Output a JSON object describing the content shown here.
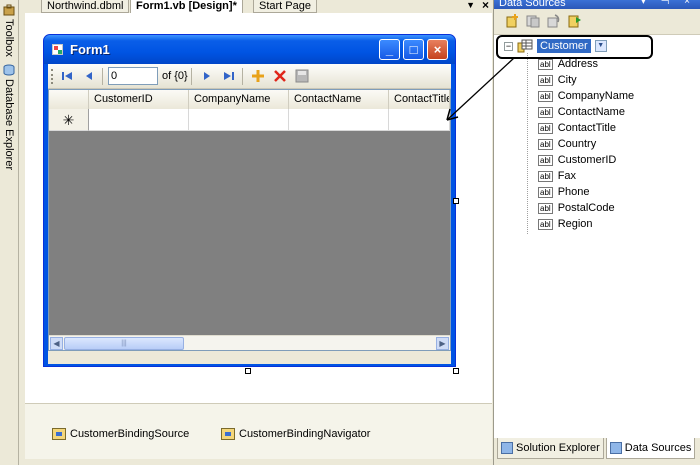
{
  "left_strip": {
    "tabs": [
      {
        "label": "Toolbox",
        "icon": "toolbox-icon"
      },
      {
        "label": "Database Explorer",
        "icon": "database-icon"
      }
    ]
  },
  "doc_tabs": {
    "items": [
      {
        "label": "Northwind.dbml",
        "active": false
      },
      {
        "label": "Form1.vb [Design]*",
        "active": true
      },
      {
        "label": "Start Page",
        "active": false
      }
    ],
    "dropdown_icon": "chevron-down-icon",
    "close_icon": "close-icon"
  },
  "form": {
    "title": "Form1",
    "navigator": {
      "position_value": "0",
      "count_label": "of {0}"
    },
    "grid": {
      "columns": [
        "CustomerID",
        "CompanyName",
        "ContactName",
        "ContactTitle"
      ],
      "new_row_marker": "✳"
    }
  },
  "tray": {
    "items": [
      "CustomerBindingSource",
      "CustomerBindingNavigator"
    ]
  },
  "data_sources": {
    "title": "Data Sources",
    "root": "Customer",
    "fields": [
      "Address",
      "City",
      "CompanyName",
      "ContactName",
      "ContactTitle",
      "Country",
      "CustomerID",
      "Fax",
      "Phone",
      "PostalCode",
      "Region"
    ],
    "field_icon_label": "abl"
  },
  "bottom_tabs": [
    {
      "label": "Solution Explorer",
      "active": false
    },
    {
      "label": "Data Sources",
      "active": true
    }
  ]
}
